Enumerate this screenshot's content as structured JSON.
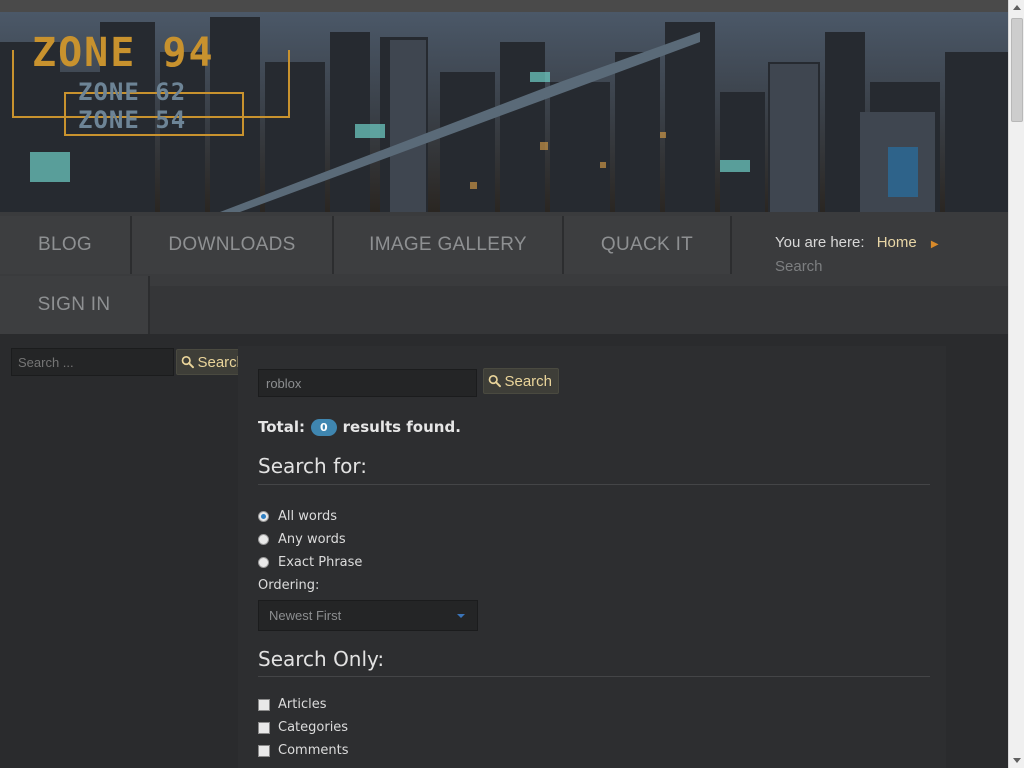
{
  "banner": {
    "logo_main": "ZONE 94",
    "logo_sub1": "ZONE 62",
    "logo_sub2": "ZONE 54"
  },
  "nav": {
    "items": [
      "BLOG",
      "DOWNLOADS",
      "IMAGE GALLERY",
      "QUACK IT",
      "SIGN IN"
    ]
  },
  "breadcrumb": {
    "label": "You are here:",
    "home": "Home",
    "current": "Search"
  },
  "sidebar": {
    "search_placeholder": "Search ...",
    "search_button": "Search"
  },
  "main": {
    "query": "roblox",
    "search_button": "Search",
    "total_label": "Total:",
    "total_count": "0",
    "total_suffix": "results found.",
    "search_for_heading": "Search for:",
    "phrase_options": [
      {
        "label": "All words",
        "selected": true
      },
      {
        "label": "Any words",
        "selected": false
      },
      {
        "label": "Exact Phrase",
        "selected": false
      }
    ],
    "ordering_label": "Ordering:",
    "ordering_value": "Newest First",
    "search_only_heading": "Search Only:",
    "areas": [
      {
        "label": "Articles",
        "checked": false
      },
      {
        "label": "Categories",
        "checked": false
      },
      {
        "label": "Comments",
        "checked": false
      }
    ]
  },
  "colors": {
    "accent_gold": "#e9d49a",
    "badge_blue": "#3f86b0",
    "logo_orange": "#c8922e"
  }
}
